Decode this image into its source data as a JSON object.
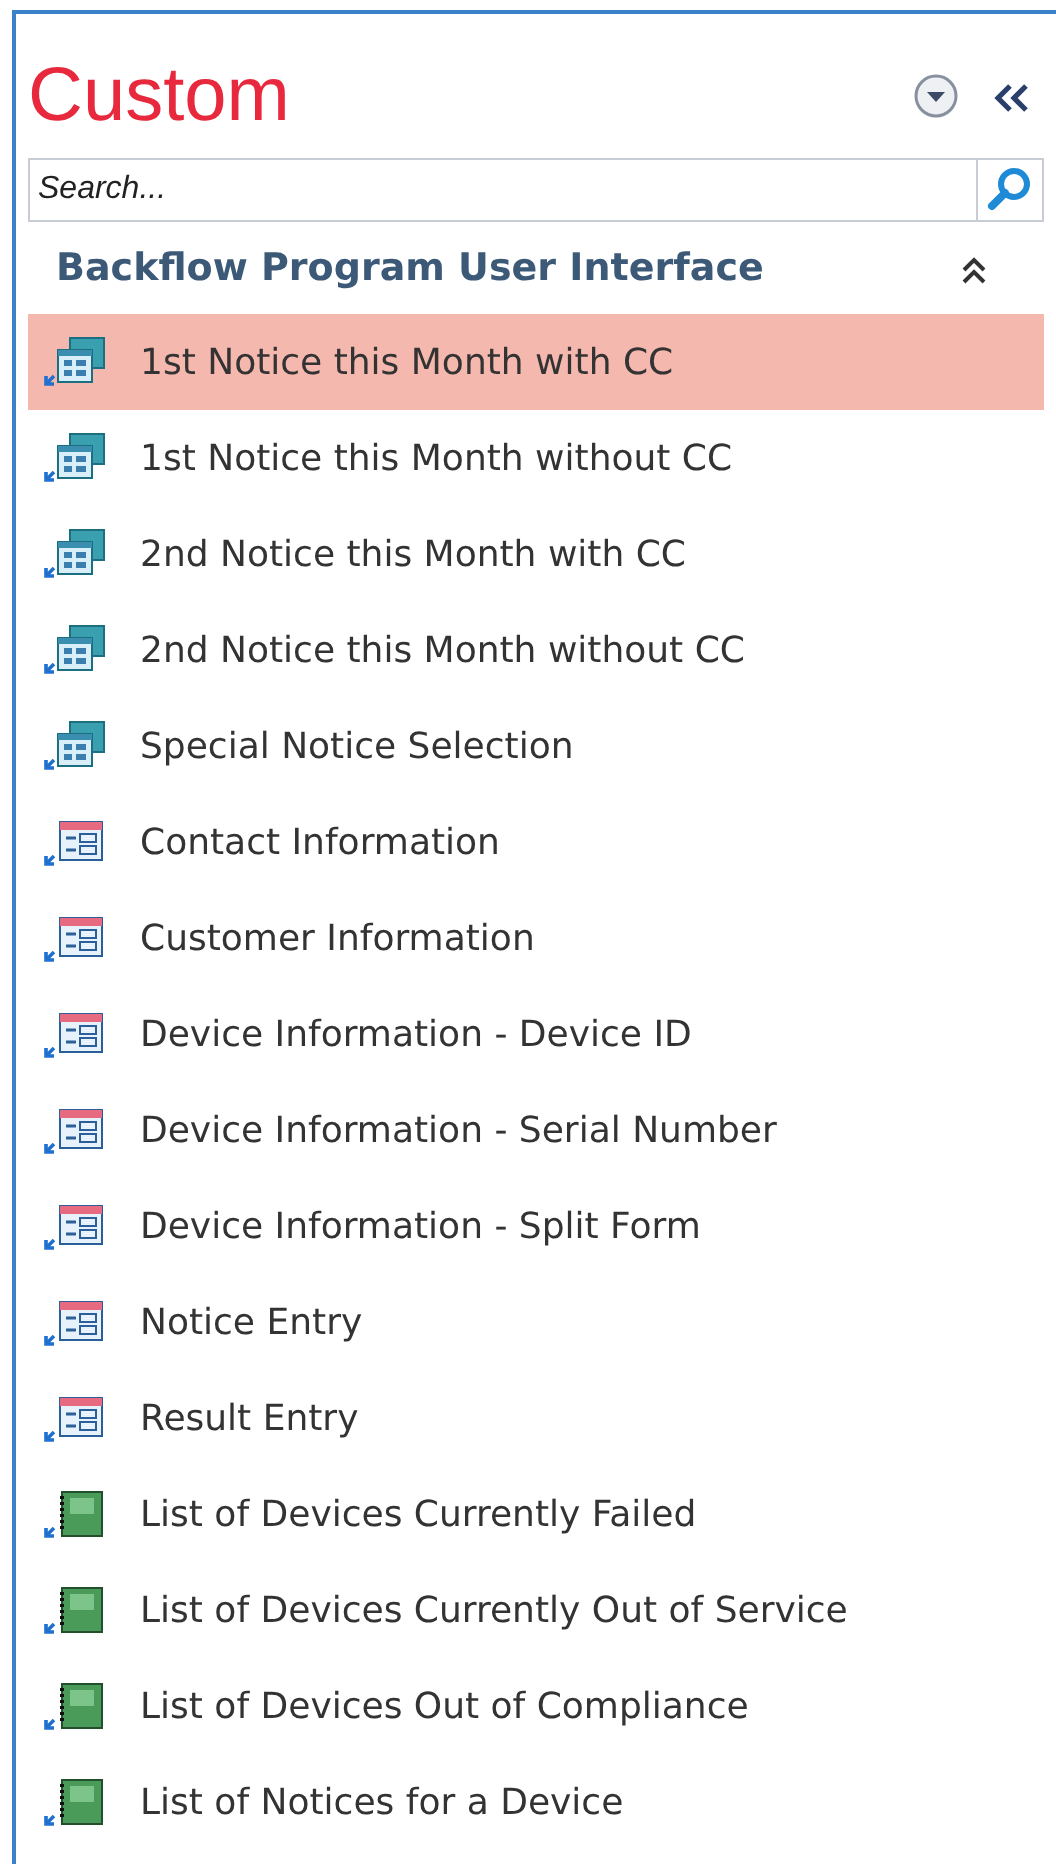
{
  "pane": {
    "title": "Custom",
    "search": {
      "placeholder": "Search..."
    }
  },
  "group": {
    "label": "Backflow Program User Interface",
    "expanded": true,
    "items": [
      {
        "label": "1st Notice this Month with CC",
        "kind": "split",
        "selected": true
      },
      {
        "label": "1st Notice this Month without CC",
        "kind": "split",
        "selected": false
      },
      {
        "label": "2nd Notice this Month with CC",
        "kind": "split",
        "selected": false
      },
      {
        "label": "2nd Notice this Month without CC",
        "kind": "split",
        "selected": false
      },
      {
        "label": "Special Notice Selection",
        "kind": "split",
        "selected": false
      },
      {
        "label": "Contact Information",
        "kind": "form",
        "selected": false
      },
      {
        "label": "Customer Information",
        "kind": "form",
        "selected": false
      },
      {
        "label": "Device Information - Device ID",
        "kind": "form",
        "selected": false
      },
      {
        "label": "Device Information - Serial Number",
        "kind": "form",
        "selected": false
      },
      {
        "label": "Device Information - Split Form",
        "kind": "form",
        "selected": false
      },
      {
        "label": "Notice Entry",
        "kind": "form",
        "selected": false
      },
      {
        "label": "Result Entry",
        "kind": "form",
        "selected": false
      },
      {
        "label": "List of Devices Currently Failed",
        "kind": "report",
        "selected": false
      },
      {
        "label": "List of Devices Currently Out of Service",
        "kind": "report",
        "selected": false
      },
      {
        "label": "List of Devices Out of Compliance",
        "kind": "report",
        "selected": false
      },
      {
        "label": "List of Notices for a Device",
        "kind": "report",
        "selected": false
      }
    ]
  }
}
